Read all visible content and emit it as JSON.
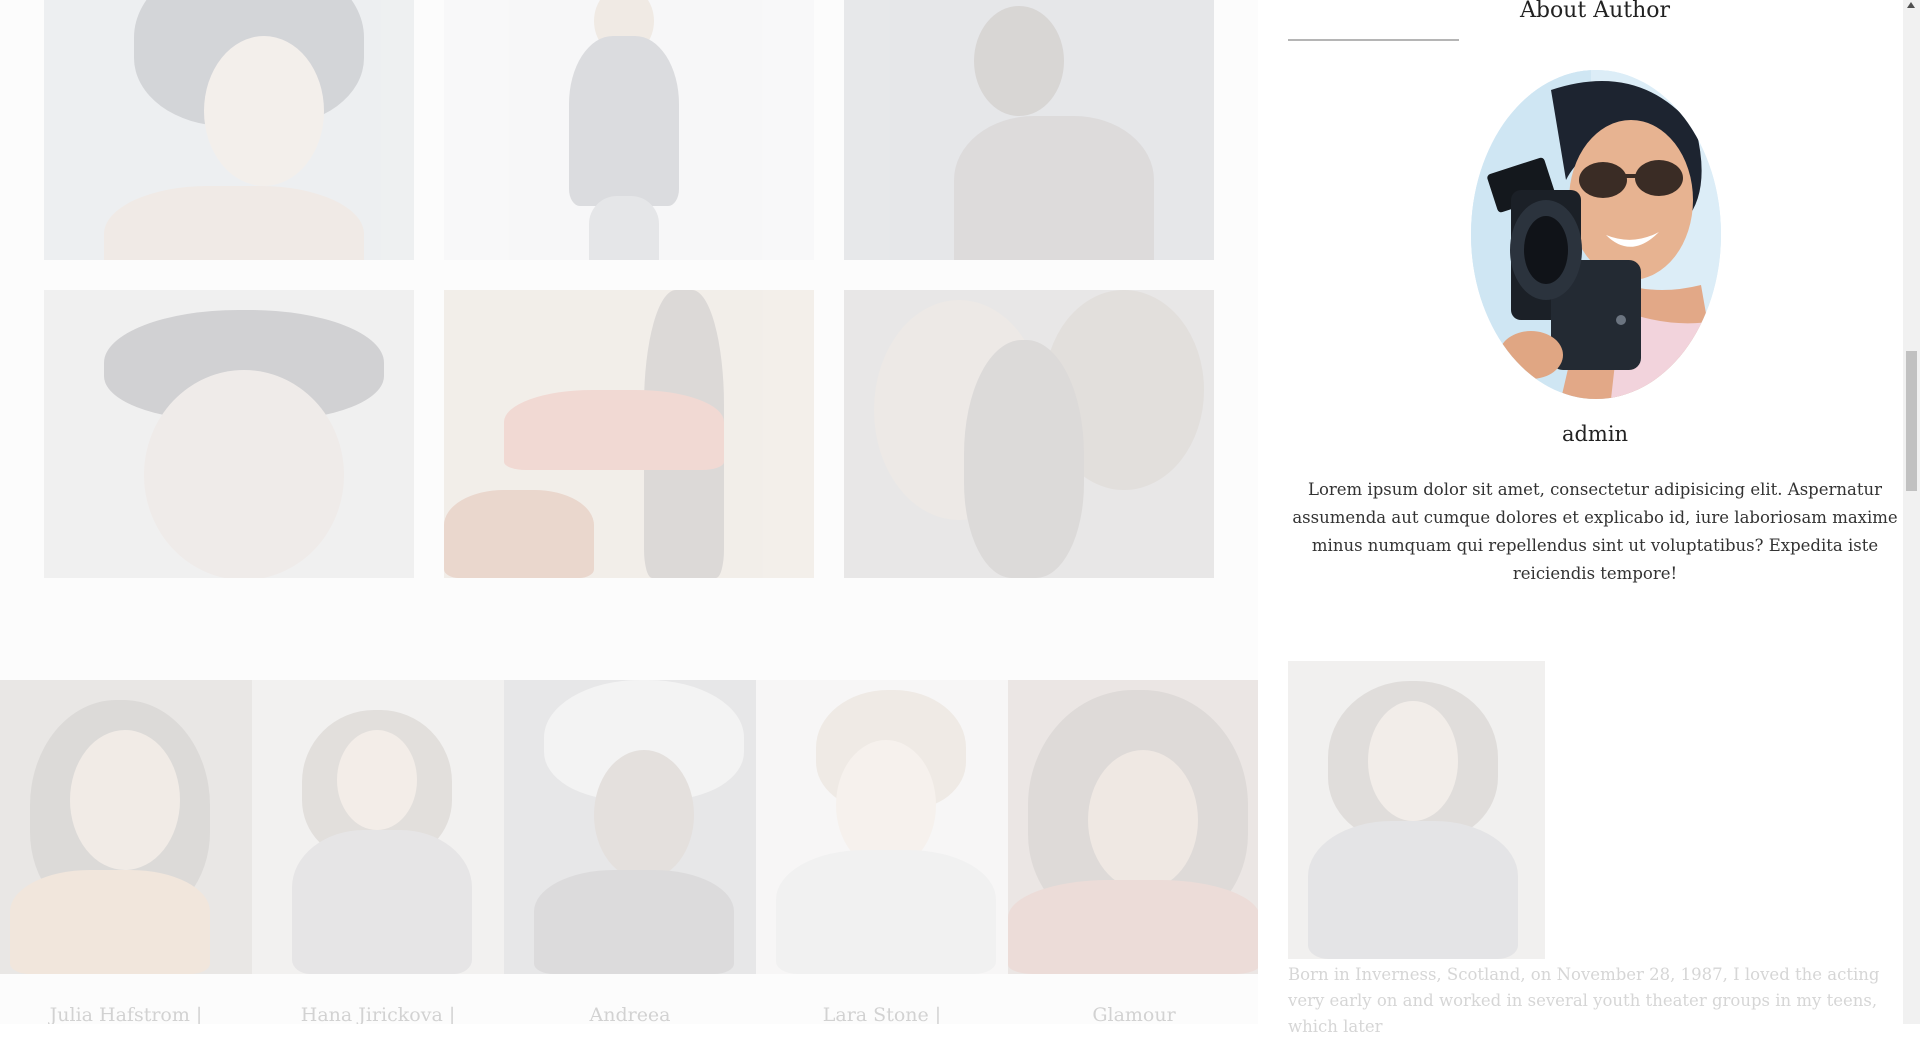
{
  "sidebar": {
    "widget_title": "About Author",
    "author_name": "admin",
    "author_bio": "Lorem ipsum dolor sit amet, consectetur adipisicing elit. Aspernatur assumenda aut cumque dolores et explicabo id, iure laboriosam maxime minus numquam qui repellendus sint ut voluptatibus? Expedita iste reiciendis tempore!",
    "bio_excerpt": "Born in Inverness, Scotland, on November 28, 1987, I loved the acting very early on and worked in several youth theater groups in my teens, which later"
  },
  "gallery": {
    "captions": [
      "Julia Hafstrom |",
      "Hana Jirickova |",
      "Andreea",
      "Lara Stone |",
      "Glamour"
    ]
  },
  "colors": {
    "accent_rule": "#b5b5b5",
    "faded_text": "#d6d6d6"
  }
}
